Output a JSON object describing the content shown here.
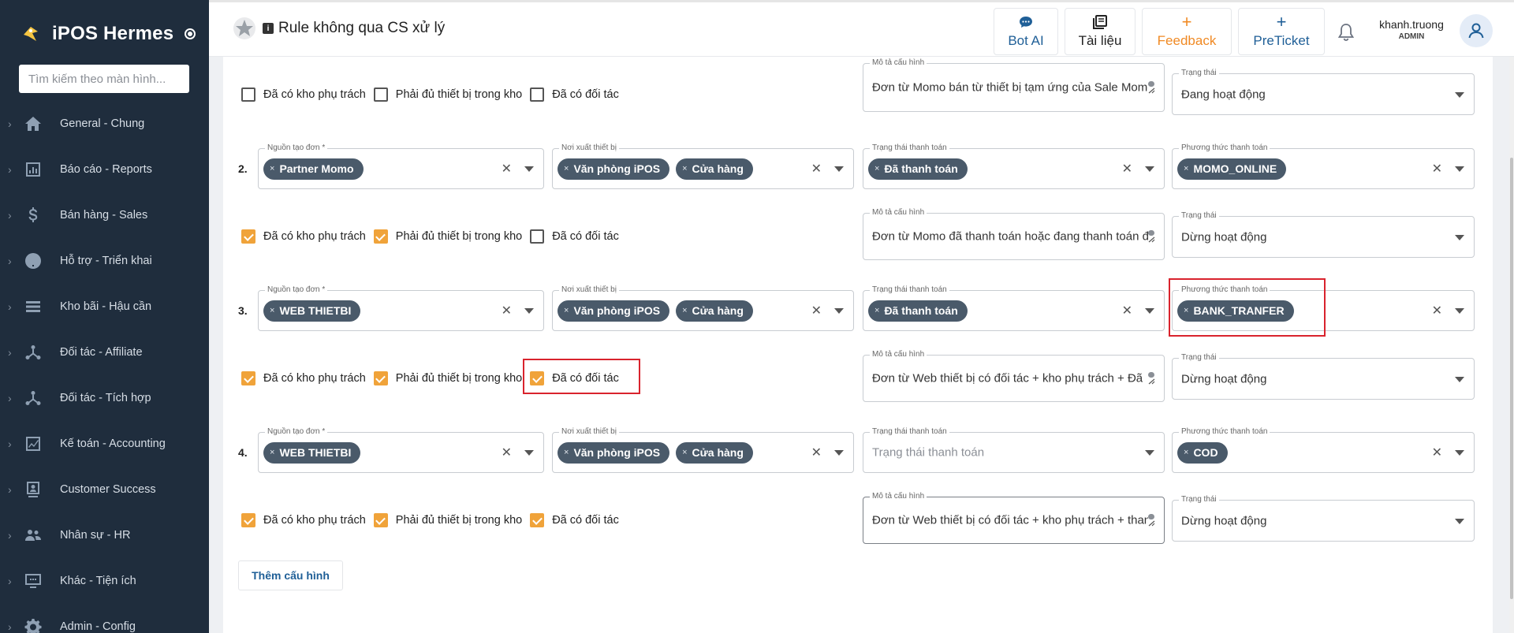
{
  "sidebar": {
    "brand": "iPOS Hermes",
    "search_placeholder": "Tìm kiếm theo màn hình...",
    "items": [
      {
        "label": "General - Chung",
        "icon": "home-icon"
      },
      {
        "label": "Báo cáo - Reports",
        "icon": "report-icon"
      },
      {
        "label": "Bán hàng - Sales",
        "icon": "dollar-icon"
      },
      {
        "label": "Hỗ trợ - Triển khai",
        "icon": "help-icon"
      },
      {
        "label": "Kho bãi - Hậu cần",
        "icon": "list-icon"
      },
      {
        "label": "Đối tác - Affiliate",
        "icon": "share-icon"
      },
      {
        "label": "Đối tác - Tích hợp",
        "icon": "share-icon"
      },
      {
        "label": "Kế toán - Accounting",
        "icon": "chart-icon"
      },
      {
        "label": "Customer Success",
        "icon": "badge-icon"
      },
      {
        "label": "Nhân sự - HR",
        "icon": "people-icon"
      },
      {
        "label": "Khác - Tiện ích",
        "icon": "monitor-icon"
      },
      {
        "label": "Admin - Config",
        "icon": "gear-icon"
      }
    ]
  },
  "header": {
    "title": "Rule không qua CS xử lý",
    "buttons": {
      "bot": "Bot AI",
      "docs": "Tài liệu",
      "feedback": "Feedback",
      "preticket": "PreTicket"
    },
    "user": {
      "name": "khanh.truong",
      "role": "ADMIN"
    }
  },
  "labels": {
    "order_source": "Nguồn tạo đơn *",
    "device_origin": "Nơi xuất thiết bị",
    "payment_status": "Trạng thái thanh toán",
    "payment_method": "Phương thức thanh toán",
    "config_desc": "Mô tả cấu hình",
    "status": "Trạng thái",
    "cb_warehouse": "Đã có kho phụ trách",
    "cb_enough_device": "Phải đủ thiết bị trong kho",
    "cb_partner": "Đã có đối tác",
    "add_config": "Thêm cấu hình"
  },
  "top_partial": {
    "checks": [
      false,
      false,
      false
    ],
    "description": "Đơn từ Momo bán từ thiết bị tạm ứng của Sale Momo",
    "status": "Đang hoạt động"
  },
  "rules": [
    {
      "num": "2.",
      "sources": [
        "Partner Momo"
      ],
      "origins": [
        "Văn phòng iPOS",
        "Cửa hàng"
      ],
      "payment_status": [
        "Đã thanh toán"
      ],
      "payment_method": [
        "MOMO_ONLINE"
      ],
      "checks": [
        true,
        true,
        false
      ],
      "description": "Đơn từ Momo đã thanh toán hoặc đang thanh toán đã",
      "status": "Dừng hoạt động"
    },
    {
      "num": "3.",
      "sources": [
        "WEB THIETBI"
      ],
      "origins": [
        "Văn phòng iPOS",
        "Cửa hàng"
      ],
      "payment_status": [
        "Đã thanh toán"
      ],
      "payment_method": [
        "BANK_TRANFER"
      ],
      "checks": [
        true,
        true,
        true
      ],
      "description": "Đơn từ Web thiết bị có đối tác + kho phụ trách + Đã",
      "status": "Dừng hoạt động"
    },
    {
      "num": "4.",
      "sources": [
        "WEB THIETBI"
      ],
      "origins": [
        "Văn phòng iPOS",
        "Cửa hàng"
      ],
      "payment_status": [],
      "payment_status_placeholder": "Trạng thái thanh toán",
      "payment_method": [
        "COD"
      ],
      "checks": [
        true,
        true,
        true
      ],
      "description": "Đơn từ Web thiết bị có đối tác + kho phụ trách + thanh",
      "status": "Dừng hoạt động"
    }
  ],
  "colors": {
    "sidebar": "#1f2d3d",
    "accent": "#1f5f97",
    "feedback": "#f08a24",
    "chip": "#4a5a6a",
    "checkbox": "#f0a33a",
    "highlight": "#d9232d"
  }
}
